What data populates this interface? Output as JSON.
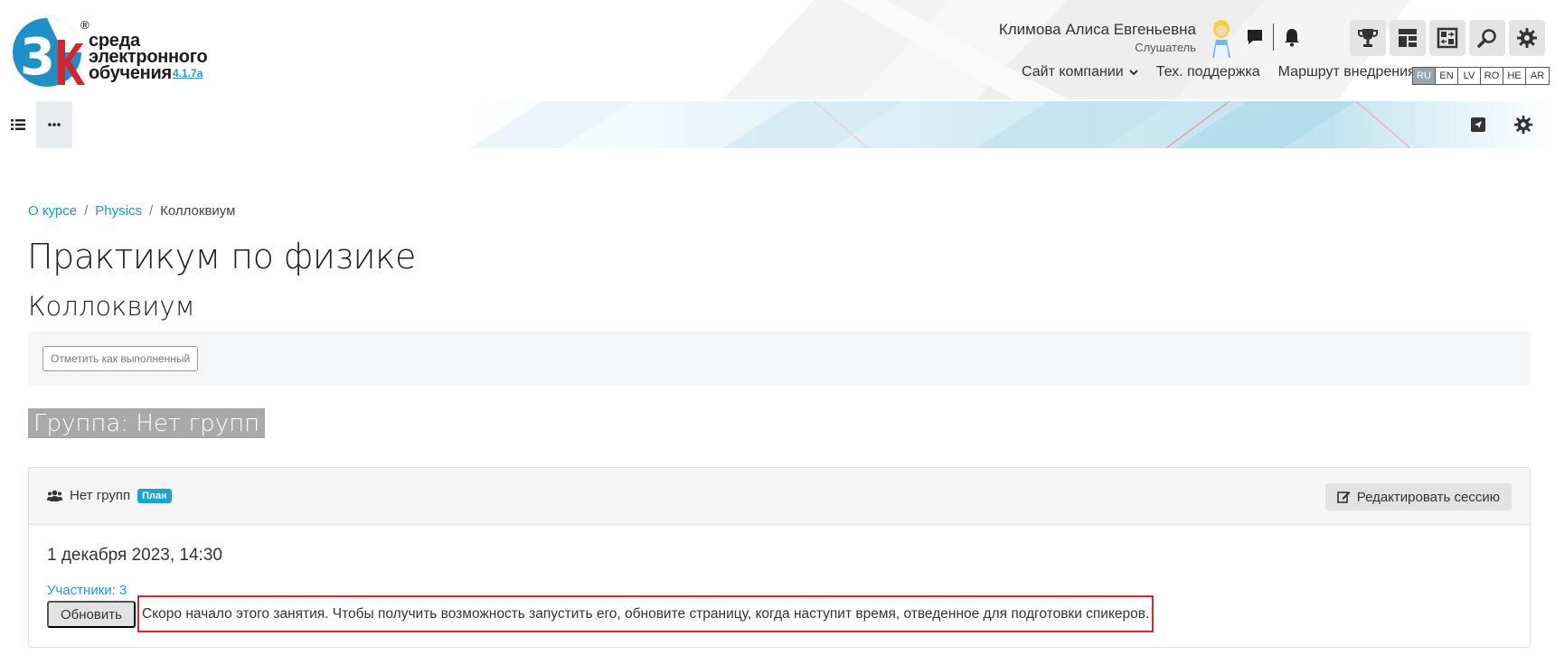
{
  "app": {
    "logo_name": "3k-logo",
    "logo_lines": [
      "среда",
      "электронного",
      "обучения"
    ],
    "logo_registered": "®",
    "version": "4.1.7a"
  },
  "user": {
    "name": "Климова Алиса Евгеньевна",
    "role": "Слушатель"
  },
  "header_icons": [
    "chat-icon",
    "bell-icon",
    "trophy-icon",
    "dashboard-icon",
    "switch-layout-icon",
    "search-icon",
    "gear-icon"
  ],
  "nav": {
    "company_site": "Сайт компании",
    "support": "Тех. поддержка",
    "route": "Маршрут внедрения"
  },
  "languages": [
    {
      "code": "RU",
      "active": true
    },
    {
      "code": "EN",
      "active": false
    },
    {
      "code": "LV",
      "active": false
    },
    {
      "code": "RO",
      "active": false
    },
    {
      "code": "HE",
      "active": false
    },
    {
      "code": "AR",
      "active": false
    }
  ],
  "breadcrumb": {
    "items": [
      "О курсе",
      "Physics",
      "Коллоквиум"
    ],
    "separator": "/"
  },
  "page": {
    "course_title": "Практикум по физике",
    "activity_title": "Коллоквиум",
    "mark_done_label": "Отметить как выполненный",
    "group_heading": "Группа: Нет групп"
  },
  "session": {
    "group_label": "Нет групп",
    "status_badge": "План",
    "edit_label": "Редактировать сессию",
    "date": "1 декабря 2023, 14:30",
    "participants": "Участники: 3",
    "refresh_label": "Обновить",
    "notice": "Скоро начало этого занятия. Чтобы получить возможность запустить его, обновите страницу, когда наступит время, отведенное для подготовки спикеров."
  },
  "colors": {
    "accent": "#1a9ad6",
    "badge": "#1ba3d0",
    "notice_border": "#e0262b",
    "logo_blue": "#1e90c8",
    "logo_red": "#d8232a"
  }
}
